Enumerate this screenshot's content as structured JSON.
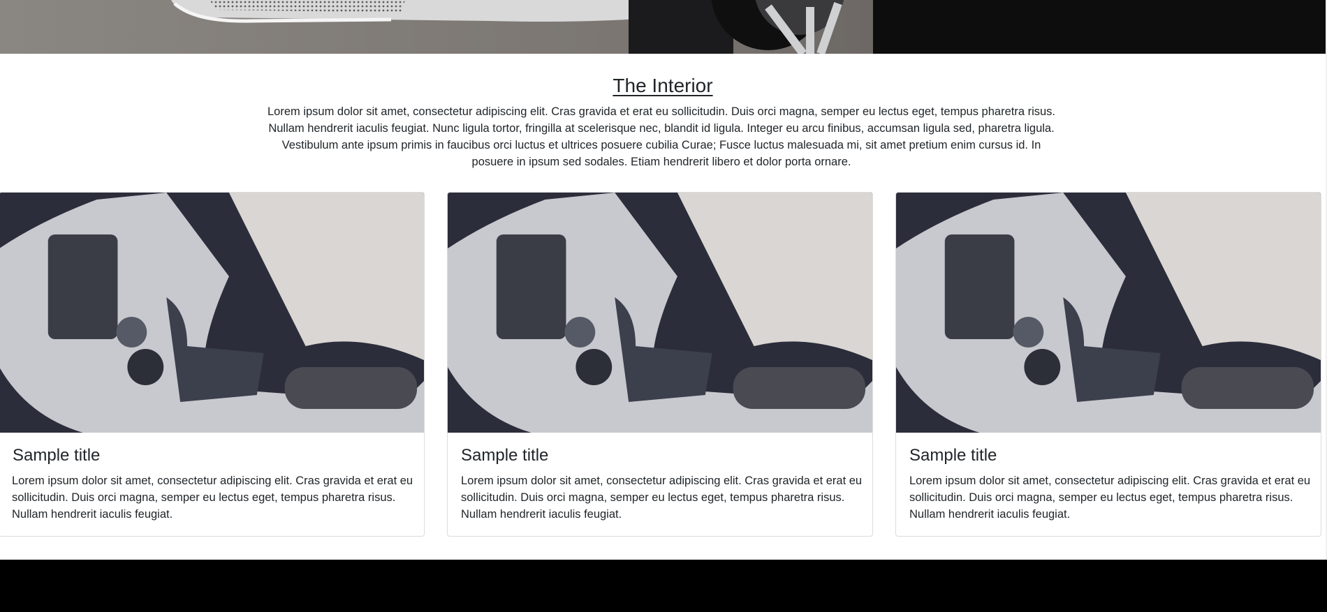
{
  "section": {
    "title": "The Interior",
    "paragraph": "Lorem ipsum dolor sit amet, consectetur adipiscing elit. Cras gravida et erat eu sollicitudin. Duis orci magna, semper eu lectus eget, tempus pharetra risus. Nullam hendrerit iaculis feugiat. Nunc ligula tortor, fringilla at scelerisque nec, blandit id ligula. Integer eu arcu finibus, accumsan ligula sed, pharetra ligula. Vestibulum ante ipsum primis in faucibus orci luctus et ultrices posuere cubilia Curae; Fusce luctus malesuada mi, sit amet pretium enim cursus id. In posuere in ipsum sed sodales. Etiam hendrerit libero et dolor porta ornare."
  },
  "cards": [
    {
      "title": "Sample title",
      "text": "Lorem ipsum dolor sit amet, consectetur adipiscing elit. Cras gravida et erat eu sollicitudin. Duis orci magna, semper eu lectus eget, tempus pharetra risus. Nullam hendrerit iaculis feugiat."
    },
    {
      "title": "Sample title",
      "text": "Lorem ipsum dolor sit amet, consectetur adipiscing elit. Cras gravida et erat eu sollicitudin. Duis orci magna, semper eu lectus eget, tempus pharetra risus. Nullam hendrerit iaculis feugiat."
    },
    {
      "title": "Sample title",
      "text": "Lorem ipsum dolor sit amet, consectetur adipiscing elit. Cras gravida et erat eu sollicitudin. Duis orci magna, semper eu lectus eget, tempus pharetra risus. Nullam hendrerit iaculis feugiat."
    }
  ],
  "colors": {
    "footer": "#000000",
    "card_border": "#dcdcdc",
    "text": "#212529"
  },
  "images": {
    "hero": "car-front-bumper-wheel-photo",
    "card": "car-interior-gear-shift-photo"
  }
}
